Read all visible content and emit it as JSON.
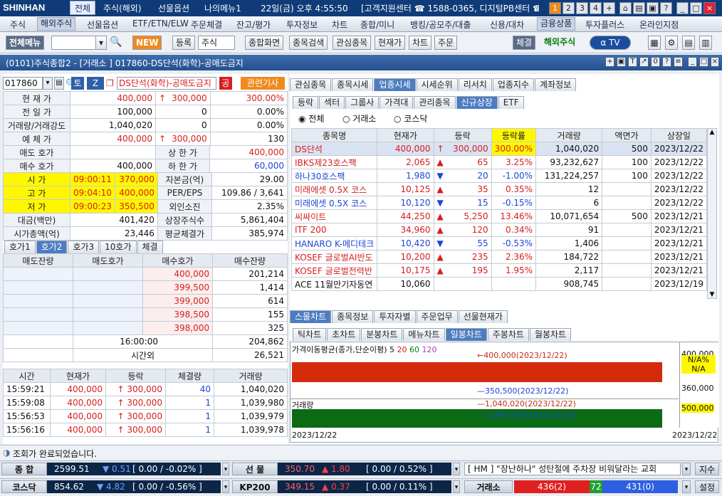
{
  "topbar": {
    "logo": "SHINHAN",
    "menus": [
      "전체",
      "주식(해외)",
      "선물옵션",
      "나의메뉴1"
    ],
    "clock": "22일(금) 오후 4:55:50",
    "support": "[고객지원센터 ☎ 1588-0365, 디지털PB센터 ☎ 0",
    "winbtns": [
      "1",
      "2",
      "3",
      "4",
      "+"
    ]
  },
  "menubar": [
    "주식",
    "해외주식",
    "선물옵션",
    "ETF/ETN/ELW",
    "주문체결",
    "잔고/평가",
    "투자정보",
    "차트",
    "종합/미니",
    "뱅킹/공모주/대출",
    "신용/대차",
    "금융상품",
    "투자플러스",
    "온라인지점"
  ],
  "toolbar": {
    "all_menu": "전체메뉴",
    "new": "NEW",
    "reg": "등록",
    "stock": "주식",
    "btns": [
      "종합화면",
      "종목검색",
      "관심종목",
      "현재가",
      "차트",
      "주문"
    ],
    "exec": "체결",
    "overseas": "해외주식"
  },
  "window": {
    "title": "(0101)주식종합2 - [거래소 ] 017860-DS단석(화학)-공매도금지"
  },
  "stock": {
    "code": "017860",
    "name": "DS단석(화학)-공매도금지",
    "t_badge": "토",
    "z_badge": "Z",
    "gong": "공",
    "news": "관련기사"
  },
  "quote": [
    {
      "l": "현 재 가",
      "v1": "400,000",
      "a": "↑",
      "v2": "300,000",
      "v3": "300.00%",
      "c": "red"
    },
    {
      "l": "전 일 가",
      "v1": "100,000",
      "a": "",
      "v2": "0",
      "v3": "0.00%",
      "c": ""
    },
    {
      "l": "거래량/거래강도",
      "v1": "1,040,020",
      "a": "",
      "v2": "0",
      "v3": "0.00%",
      "c": ""
    },
    {
      "l": "예 체 가",
      "v1": "400,000",
      "a": "↑",
      "v2": "300,000",
      "v3": "130",
      "c": "red"
    }
  ],
  "quote2": [
    {
      "l": "매도 호가",
      "v": "",
      "l2": "상 한 가",
      "v2": "400,000",
      "c2": "red"
    },
    {
      "l": "매수 호가",
      "v": "400,000",
      "l2": "하 한 가",
      "v2": "60,000",
      "c2": "blue"
    }
  ],
  "ohl": [
    {
      "l": "시 가",
      "t": "09:00:11",
      "v": "370,000",
      "l2": "자본금(억)",
      "v2": "29.00"
    },
    {
      "l": "고 가",
      "t": "09:04:10",
      "v": "400,000",
      "l2": "PER/EPS",
      "v2": "109.86 / 3,641"
    },
    {
      "l": "저 가",
      "t": "09:00:23",
      "v": "350,500",
      "l2": "외인소진",
      "v2": "2.35%"
    }
  ],
  "misc": [
    {
      "l": "대금(백만)",
      "v": "401,420",
      "l2": "상장주식수",
      "v2": "5,861,404"
    },
    {
      "l": "시가총액(억)",
      "v": "23,446",
      "l2": "평균체결가",
      "v2": "385,974"
    }
  ],
  "hogatabs": [
    "호가1",
    "호가2",
    "호가3",
    "10호가",
    "체결"
  ],
  "hogahdr": [
    "매도잔량",
    "매도호가",
    "매수호가",
    "매수잔량"
  ],
  "hoga": [
    {
      "p": "400,000",
      "q": "201,214"
    },
    {
      "p": "399,500",
      "q": "1,414"
    },
    {
      "p": "399,000",
      "q": "614"
    },
    {
      "p": "398,500",
      "q": "155"
    },
    {
      "p": "398,000",
      "q": "325"
    }
  ],
  "hogatime": "16:00:00",
  "hogatot": "204,862",
  "afterhours": "시간외",
  "afterqty": "26,521",
  "tradehdr": [
    "시간",
    "현재가",
    "등락",
    "체결량",
    "거래량"
  ],
  "trades": [
    {
      "t": "15:59:21",
      "p": "400,000",
      "d": "300,000",
      "q": "40",
      "v": "1,040,020"
    },
    {
      "t": "15:59:08",
      "p": "400,000",
      "d": "300,000",
      "q": "1",
      "v": "1,039,980"
    },
    {
      "t": "15:56:53",
      "p": "400,000",
      "d": "300,000",
      "q": "1",
      "v": "1,039,979"
    },
    {
      "t": "15:56:16",
      "p": "400,000",
      "d": "300,000",
      "q": "1",
      "v": "1,039,978"
    }
  ],
  "rtabs": [
    "관심종목",
    "종목시세",
    "업종시세",
    "시세순위",
    "리서치",
    "업종지수",
    "계좌정보"
  ],
  "rtabs2": [
    "등락",
    "섹터",
    "그룹사",
    "가격대",
    "관리종목",
    "신규상장",
    "ETF"
  ],
  "radio": [
    "전체",
    "거래소",
    "코스닥"
  ],
  "listhdr": [
    "종목명",
    "현재가",
    "등락",
    "등락률",
    "거래량",
    "액면가",
    "상장일"
  ],
  "list": [
    {
      "n": "DS단석",
      "p": "400,000",
      "a": "↑",
      "d": "300,000",
      "r": "300.00%",
      "v": "1,040,020",
      "f": "500",
      "dt": "2023/12/22",
      "c": "red"
    },
    {
      "n": "IBKS제23호스팩",
      "p": "2,065",
      "a": "▲",
      "d": "65",
      "r": "3.25%",
      "v": "93,232,627",
      "f": "100",
      "dt": "2023/12/22",
      "c": "red"
    },
    {
      "n": "하나30호스팩",
      "p": "1,980",
      "a": "▼",
      "d": "20",
      "r": "-1.00%",
      "v": "131,224,257",
      "f": "100",
      "dt": "2023/12/22",
      "c": "blue"
    },
    {
      "n": "미래에셋 0.5X 코스",
      "p": "10,125",
      "a": "▲",
      "d": "35",
      "r": "0.35%",
      "v": "12",
      "f": "",
      "dt": "2023/12/22",
      "c": "red"
    },
    {
      "n": "미래에셋 0.5X 코스",
      "p": "10,120",
      "a": "▼",
      "d": "15",
      "r": "-0.15%",
      "v": "6",
      "f": "",
      "dt": "2023/12/22",
      "c": "blue"
    },
    {
      "n": "씨싸이트",
      "p": "44,250",
      "a": "▲",
      "d": "5,250",
      "r": "13.46%",
      "v": "10,071,654",
      "f": "500",
      "dt": "2023/12/21",
      "c": "red"
    },
    {
      "n": "ITF 200",
      "p": "34,960",
      "a": "▲",
      "d": "120",
      "r": "0.34%",
      "v": "91",
      "f": "",
      "dt": "2023/12/21",
      "c": "red"
    },
    {
      "n": "HANARO K-메디테크",
      "p": "10,420",
      "a": "▼",
      "d": "55",
      "r": "-0.53%",
      "v": "1,406",
      "f": "",
      "dt": "2023/12/21",
      "c": "blue"
    },
    {
      "n": "KOSEF 글로벌AI반도",
      "p": "10,200",
      "a": "▲",
      "d": "235",
      "r": "2.36%",
      "v": "184,722",
      "f": "",
      "dt": "2023/12/21",
      "c": "red"
    },
    {
      "n": "KOSEF 글로벌전력반",
      "p": "10,175",
      "a": "▲",
      "d": "195",
      "r": "1.95%",
      "v": "2,117",
      "f": "",
      "dt": "2023/12/21",
      "c": "red"
    },
    {
      "n": "ACE 11월만기자동연",
      "p": "10,060",
      "a": "",
      "d": "",
      "r": "",
      "v": "908,745",
      "f": "",
      "dt": "2023/12/19",
      "c": ""
    }
  ],
  "ctabs": [
    "스몰차트",
    "종목정보",
    "투자자별",
    "주문업무",
    "선물현재가"
  ],
  "ctabs2": [
    "틱차트",
    "초차트",
    "분봉차트",
    "메뉴차트",
    "일봉차트",
    "주봉차트",
    "월봉차트"
  ],
  "chart": {
    "ma": "가격이동평균(종가,단순이평) 5",
    "ma20": "20",
    "ma60": "60",
    "ma120": "120",
    "hi": "400,000(2023/12/22)",
    "lo": "350,500(2023/12/22)",
    "vol": "거래량",
    "vhi": "1,040,020(2023/12/22)",
    "vlo": "1,040,020(2023/12/22)",
    "date1": "2023/12/22",
    "date2": "2023/12/22",
    "y1": "400,000",
    "y2": "360,000",
    "y3": "500,000",
    "na1": "N/A%",
    "na2": "N/A"
  },
  "status": "조회가 완료되었습니다.",
  "ticker1": {
    "n": "종 합",
    "v": "2599.51",
    "d": "▼ 0.51",
    "b": "[ 0.00 / -0.02% ]",
    "n2": "선 물",
    "v2": "350.70",
    "d2": "▲ 1.80",
    "b2": "[ 0.00 / 0.52% ]",
    "news": "[ HM ] \"장난하나\" 성탄절에 주차장 비워달라는 교회",
    "btn": "지수"
  },
  "ticker2": {
    "n": "코스닥",
    "v": "854.62",
    "d": "▼ 4.82",
    "b": "[ 0.00 / -0.56% ]",
    "n2": "KP200",
    "v2": "349.15",
    "d2": "▲ 0.37",
    "b2": "[ 0.00 / 0.11% ]",
    "n3": "거래소",
    "r1": "436(2)",
    "r2": "72",
    "r3": "431(0)",
    "btn": "설정"
  }
}
